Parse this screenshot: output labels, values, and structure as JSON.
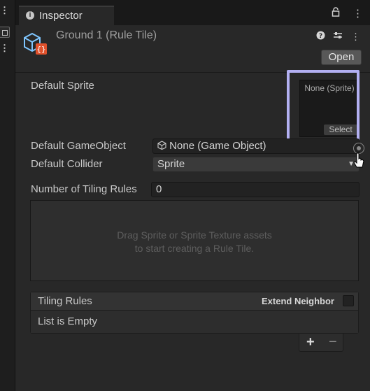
{
  "window": {
    "tab_label": "Inspector",
    "top_icons": [
      "lock-icon",
      "kebab-menu-icon"
    ]
  },
  "header": {
    "asset_title": "Ground 1 (Rule Tile)",
    "open_label": "Open",
    "icons": [
      "help-icon",
      "preset-icon",
      "kebab-menu-icon"
    ]
  },
  "fields": {
    "default_sprite_label": "Default Sprite",
    "default_sprite_value": "None (Sprite)",
    "select_label": "Select",
    "default_gameobject_label": "Default GameObject",
    "default_gameobject_value": "None (Game Object)",
    "default_collider_label": "Default Collider",
    "default_collider_value": "Sprite",
    "tiling_rules_count_label": "Number of Tiling Rules",
    "tiling_rules_count_value": "0"
  },
  "dropzone": {
    "line1": "Drag Sprite or Sprite Texture assets",
    "line2": "to start creating a Rule Tile."
  },
  "tiling_rules": {
    "title": "Tiling Rules",
    "extend_neighbor_label": "Extend Neighbor",
    "empty_text": "List is Empty",
    "add_label": "+",
    "remove_label": "−"
  },
  "colors": {
    "highlight": "#b3b0f2",
    "panel_bg": "#282828",
    "field_bg": "#222222"
  }
}
